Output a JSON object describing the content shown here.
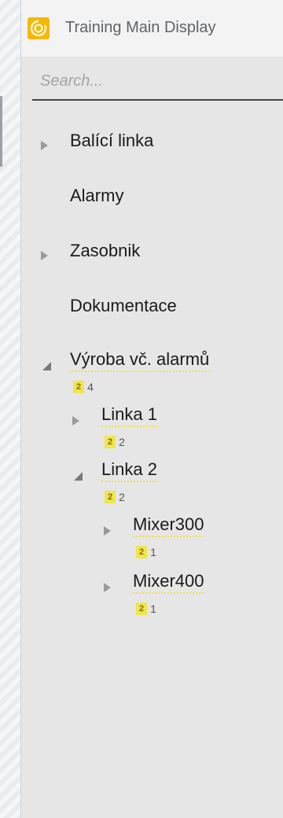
{
  "header": {
    "title": "Training Main Display",
    "logo_icon": "swirl-logo-icon"
  },
  "search": {
    "placeholder": "Search..."
  },
  "tree": {
    "balici": {
      "label": "Balící linka",
      "state": "collapsed"
    },
    "alarmy": {
      "label": "Alarmy"
    },
    "zasobnik": {
      "label": "Zasobnik",
      "state": "collapsed"
    },
    "dokumentace": {
      "label": "Dokumentace"
    },
    "vyroba": {
      "label": "Výroba vč. alarmů",
      "state": "expanded",
      "badge": "2",
      "count": "4"
    },
    "linka1": {
      "label": "Linka 1",
      "state": "collapsed",
      "badge": "2",
      "count": "2"
    },
    "linka2": {
      "label": "Linka 2",
      "state": "expanded",
      "badge": "2",
      "count": "2"
    },
    "mixer300": {
      "label": "Mixer300",
      "state": "collapsed",
      "badge": "2",
      "count": "1"
    },
    "mixer400": {
      "label": "Mixer400",
      "state": "collapsed",
      "badge": "2",
      "count": "1"
    }
  },
  "colors": {
    "accent": "#f5b800",
    "badge": "#efe64f",
    "background": "#e6e6e6"
  }
}
